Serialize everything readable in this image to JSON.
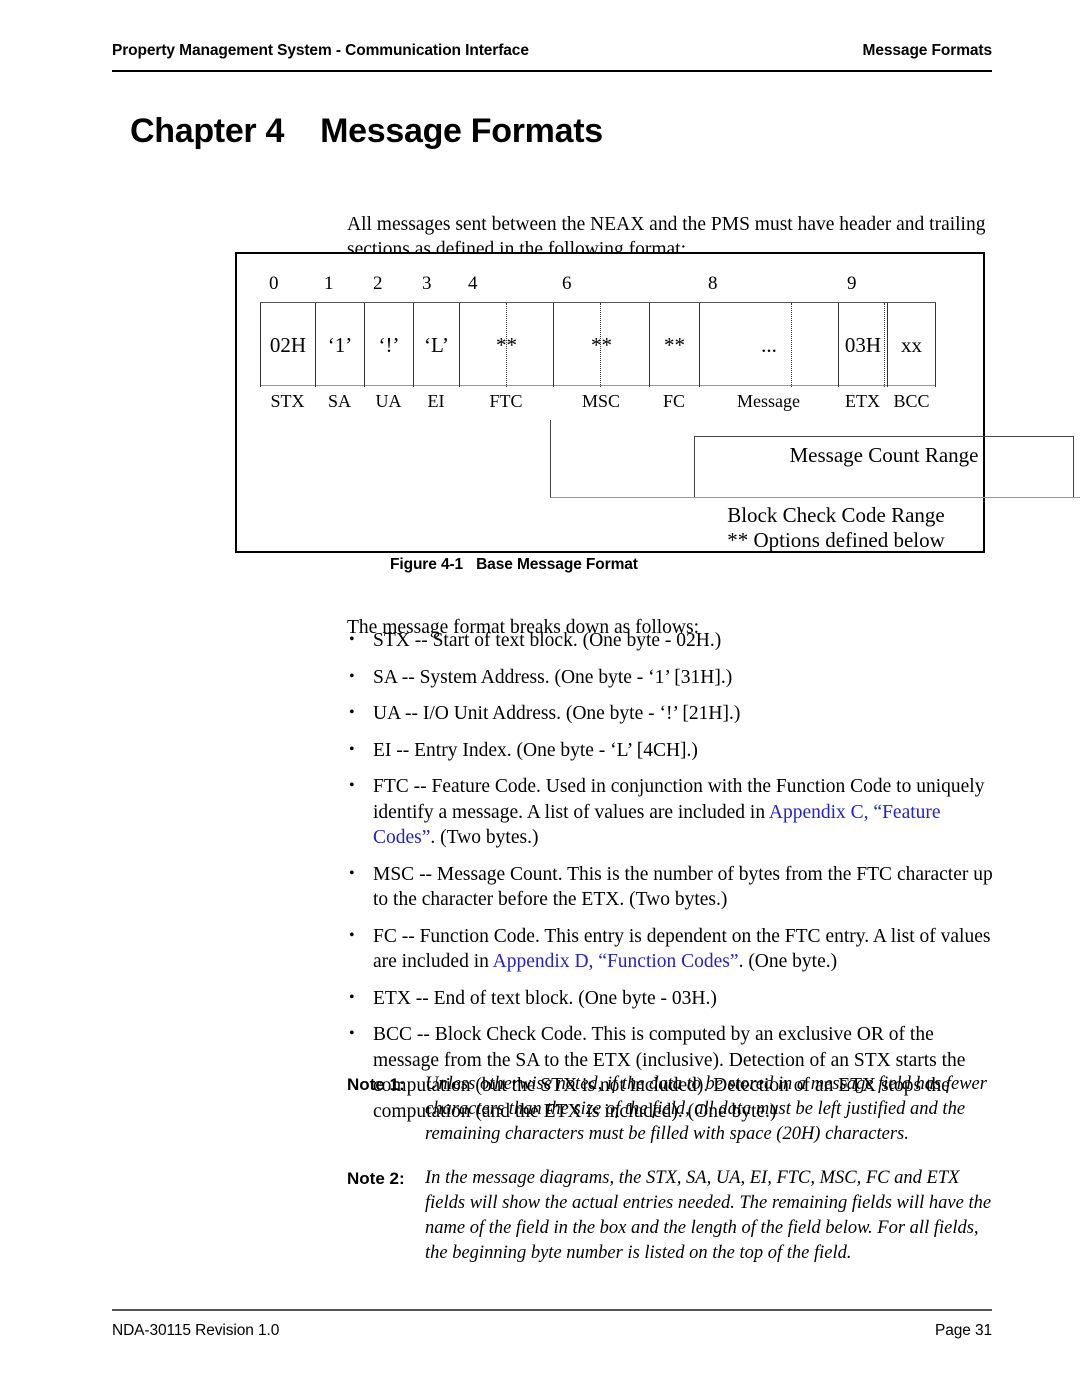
{
  "header": {
    "left": "Property Management System - Communication Interface",
    "right": "Message Formats"
  },
  "chapter": {
    "number": "Chapter 4",
    "title": "Message Formats"
  },
  "intro": "All messages sent between the NEAX and the PMS must have header and trailing sections as defined in the following format:",
  "figure": {
    "caption_number": "Figure 4-1",
    "caption_title": "Base Message Format",
    "byte_numbers": [
      "0",
      "1",
      "2",
      "3",
      "4",
      "6",
      "8",
      "9"
    ],
    "cells": [
      {
        "value": "02H",
        "label": "STX"
      },
      {
        "value": "‘1’",
        "label": "SA"
      },
      {
        "value": "‘!’",
        "label": "UA"
      },
      {
        "value": "‘L’",
        "label": "EI"
      },
      {
        "value": "**",
        "label": "FTC"
      },
      {
        "value": "**",
        "label": "MSC"
      },
      {
        "value": "**",
        "label": "FC"
      },
      {
        "value": "...",
        "label": "Message"
      },
      {
        "value": "03H",
        "label": "ETX"
      },
      {
        "value": "xx",
        "label": "BCC"
      }
    ],
    "message_count_range": "Message Count Range",
    "block_check_code_range": "Block Check Code Range",
    "options_note": "** Options defined below"
  },
  "breakdown_intro": "The message format breaks down as follows:",
  "bullets": [
    {
      "parts": [
        {
          "t": "STX -- Start of text block. (One byte - 02H.)",
          "link": false
        }
      ]
    },
    {
      "parts": [
        {
          "t": "SA -- System Address. (One byte - ‘1’ [31H].)",
          "link": false
        }
      ]
    },
    {
      "parts": [
        {
          "t": "UA -- I/O Unit Address. (One byte - ‘!’ [21H].)",
          "link": false
        }
      ]
    },
    {
      "parts": [
        {
          "t": "EI -- Entry Index. (One byte - ‘L’ [4CH].)",
          "link": false
        }
      ]
    },
    {
      "parts": [
        {
          "t": "FTC -- Feature Code. Used in conjunction with the Function Code to uniquely identify a message. A list of values are included in ",
          "link": false
        },
        {
          "t": "Appendix C, “Feature Codes”",
          "link": true
        },
        {
          "t": ". (Two bytes.)",
          "link": false
        }
      ]
    },
    {
      "parts": [
        {
          "t": "MSC -- Message Count. This is the number of bytes from the FTC character up to the character before the ETX. (Two bytes.)",
          "link": false
        }
      ]
    },
    {
      "parts": [
        {
          "t": "FC -- Function Code. This entry is dependent on the FTC entry. A list of values are included in ",
          "link": false
        },
        {
          "t": "Appendix D, “Function Codes”",
          "link": true
        },
        {
          "t": ". (One byte.)",
          "link": false
        }
      ]
    },
    {
      "parts": [
        {
          "t": "ETX -- End of text block. (One byte - 03H.)",
          "link": false
        }
      ]
    },
    {
      "parts": [
        {
          "t": "BCC -- Block Check Code. This is computed by an exclusive OR of the message from the SA to the ETX (inclusive). Detection of an STX starts the computation (but the STX is not included). Detection of an ETX stops the computation (and the ETX is included). (One byte.)",
          "link": false
        }
      ]
    }
  ],
  "notes": [
    {
      "label": "Note 1:",
      "text": "Unless otherwise noted, if the data to be stored in a message field has fewer characters than the size of the field, all data must be left justified and the remaining characters must be filled with space (20H) characters."
    },
    {
      "label": "Note 2:",
      "text": "In the message diagrams, the STX, SA, UA, EI, FTC, MSC, FC and ETX fields will show the actual entries needed. The remaining fields will have the name of the field in the box and the length of the field below. For all fields, the beginning byte number is listed on the top of the field."
    }
  ],
  "footer": {
    "left": "NDA-30115  Revision 1.0",
    "right": "Page 31"
  },
  "colors": {
    "link": "#2222cc",
    "text": "#000000"
  }
}
